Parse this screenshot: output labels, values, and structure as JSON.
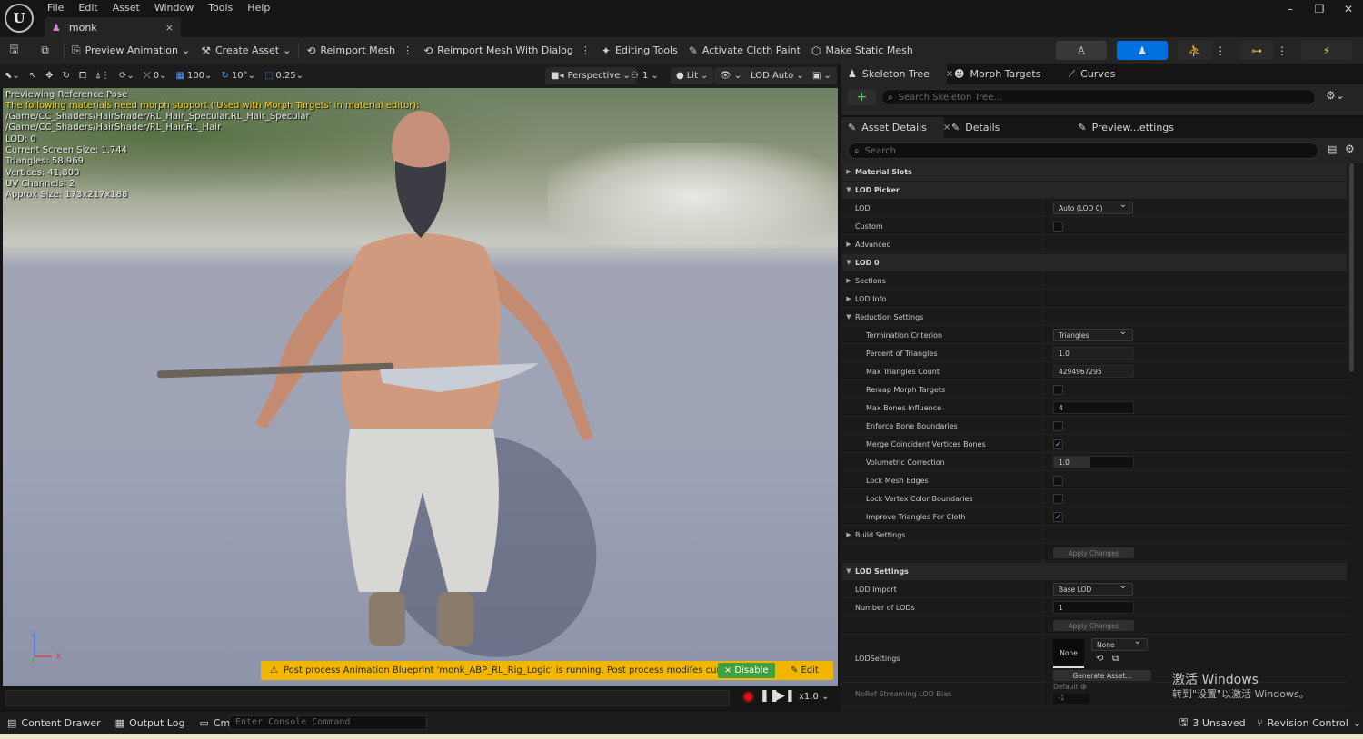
{
  "menu": [
    "File",
    "Edit",
    "Asset",
    "Window",
    "Tools",
    "Help"
  ],
  "document_tab": {
    "label": "monk",
    "close": "×"
  },
  "window_controls": {
    "minimize": "–",
    "maximize": "❐",
    "close": "✕"
  },
  "toolbar": {
    "save_icon": "save-icon",
    "browse_icon": "browse-icon",
    "preview_animation": "Preview Animation",
    "create_asset": "Create Asset",
    "reimport_mesh": "Reimport Mesh",
    "reimport_mesh_dialog": "Reimport Mesh With Dialog",
    "editing_tools": "Editing Tools",
    "activate_cloth_paint": "Activate Cloth Paint",
    "make_static_mesh": "Make Static Mesh"
  },
  "viewport_toolbar": {
    "rotate_snap": "0",
    "grid_snap": "100",
    "angle_snap": "10°",
    "scale_snap": "0.25",
    "view_mode": "Perspective",
    "camera_speed": "1",
    "lighting": "Lit",
    "lod": "LOD Auto"
  },
  "viewport_info": {
    "line1": "Previewing Reference Pose",
    "line2": "The following materials need morph support ('Used with Morph Targets' in material editor):",
    "line3": "/Game/CC_Shaders/HairShader/RL_Hair_Specular.RL_Hair_Specular",
    "line4": "/Game/CC_Shaders/HairShader/RL_Hair.RL_Hair",
    "line5": "LOD: 0",
    "line6": "Current Screen Size: 1.744",
    "line7": "Triangles: 58,969",
    "line8": "Vertices: 41,800",
    "line9": "UV Channels: 2",
    "line10": "Approx Size: 173x217x188"
  },
  "axes": {
    "z": "Z",
    "x": "X"
  },
  "warning": {
    "text": "Post process Animation Blueprint 'monk_ABP_RL_Rig_Logic' is running. Post process modifes curves.",
    "disable": "Disable",
    "edit": "Edit"
  },
  "playback": {
    "speed": "x1.0"
  },
  "skeleton_tabs": {
    "skeleton_tree": "Skeleton Tree",
    "morph_targets": "Morph Targets",
    "curves": "Curves",
    "search_placeholder": "Search Skeleton Tree..."
  },
  "details_tabs": {
    "asset_details": "Asset Details",
    "details": "Details",
    "preview_settings": "Preview...ettings",
    "search_placeholder": "Search"
  },
  "details": {
    "material_slots": "Material Slots",
    "lod_picker": "LOD Picker",
    "lod": "LOD",
    "lod_value": "Auto (LOD 0)",
    "custom": "Custom",
    "advanced": "Advanced",
    "lod0": "LOD 0",
    "sections": "Sections",
    "lod_info": "LOD Info",
    "reduction_settings": "Reduction Settings",
    "termination_criterion": "Termination Criterion",
    "termination_value": "Triangles",
    "percent_triangles": "Percent of Triangles",
    "percent_triangles_value": "1.0",
    "max_triangles_count": "Max Triangles Count",
    "max_triangles_value": "4294967295",
    "remap_morph_targets": "Remap Morph Targets",
    "max_bones_influence": "Max Bones Influence",
    "max_bones_value": "4",
    "enforce_bone_boundaries": "Enforce Bone Boundaries",
    "merge_coincident": "Merge Coincident Vertices Bones",
    "volumetric_correction": "Volumetric Correction",
    "volumetric_value": "1.0",
    "lock_mesh_edges": "Lock Mesh Edges",
    "lock_vertex_color": "Lock Vertex Color Boundaries",
    "improve_triangles": "Improve Triangles For Cloth",
    "build_settings": "Build Settings",
    "apply_changes": "Apply Changes",
    "lod_settings": "LOD Settings",
    "lod_import": "LOD Import",
    "lod_import_value": "Base LOD",
    "number_of_lods": "Number of LODs",
    "number_of_lods_value": "1",
    "apply_changes2": "Apply Changes",
    "lodsettings": "LODSettings",
    "lodsettings_thumb": "None",
    "lodsettings_value": "None",
    "generate_asset": "Generate Asset...",
    "noref_streaming": "NoRef Streaming LOD Bias",
    "default": "Default",
    "noref_value": "-1"
  },
  "watermark": {
    "line1": "激活 Windows",
    "line2": "转到\"设置\"以激活 Windows。"
  },
  "statusbar": {
    "content_drawer": "Content Drawer",
    "output_log": "Output Log",
    "cmd": "Cmd",
    "console_placeholder": "Enter Console Command",
    "unsaved": "3 Unsaved",
    "revision_control": "Revision Control"
  },
  "colors": {
    "accent_blue": "#0070e0",
    "warning_yellow": "#f2b600",
    "disable_green": "#3fa142"
  }
}
